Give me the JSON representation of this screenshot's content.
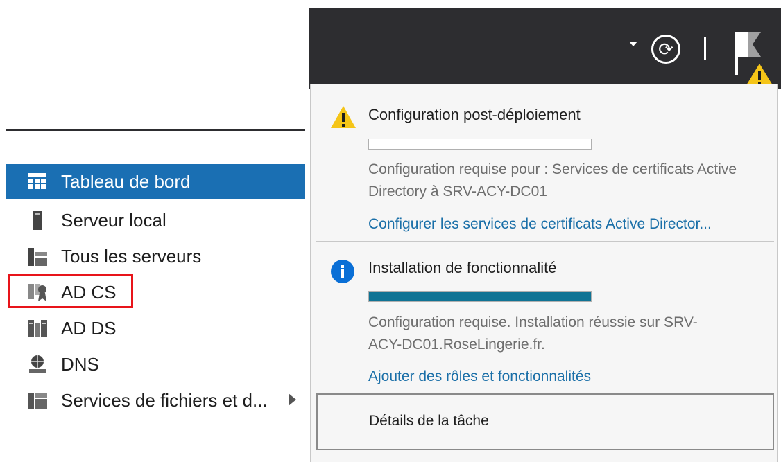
{
  "toolbar": {
    "icons": [
      "chevron-down-icon",
      "refresh-icon",
      "flag-warning-icon"
    ]
  },
  "nav": {
    "items": [
      {
        "label": "Tableau de bord",
        "icon": "dashboard-icon",
        "active": true
      },
      {
        "label": "Serveur local",
        "icon": "server-icon"
      },
      {
        "label": "Tous les serveurs",
        "icon": "servers-icon"
      },
      {
        "label": "AD CS",
        "icon": "certificate-icon"
      },
      {
        "label": "AD DS",
        "icon": "directory-icon"
      },
      {
        "label": "DNS",
        "icon": "dns-icon"
      },
      {
        "label": "Services de fichiers et d...",
        "icon": "file-services-icon",
        "expandable": true
      }
    ]
  },
  "notifications": [
    {
      "type": "warning",
      "icon": "warning-icon",
      "title": "Configuration post-déploiement",
      "progress": 0,
      "description": "Configuration requise pour : Services de certificats Active Directory à SRV-ACY-DC01",
      "link": "Configurer les services de certificats Active Director..."
    },
    {
      "type": "info",
      "icon": "info-icon",
      "title": "Installation de fonctionnalité",
      "progress": 1.0,
      "description": "Configuration requise. Installation réussie sur SRV-ACY-DC01.RoseLingerie.fr.",
      "link": "Ajouter des rôles et fonctionnalités"
    }
  ],
  "task_details_label": "Détails de la tâche",
  "colors": {
    "toolbar_bg": "#2d2d30",
    "nav_active": "#1a6fb3",
    "link": "#1a6fa8",
    "progress_fill": "#0f7394",
    "warning": "#f5c518",
    "info": "#0a6fd6",
    "highlight": "#e8141a"
  }
}
